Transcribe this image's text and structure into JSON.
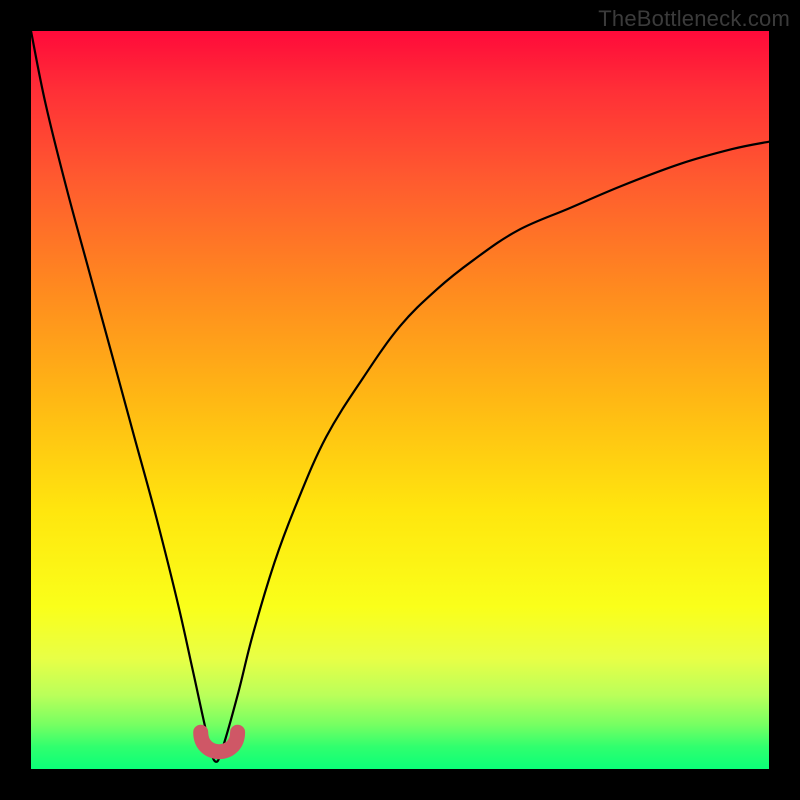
{
  "watermark": "TheBottleneck.com",
  "chart_data": {
    "type": "line",
    "title": "",
    "xlabel": "",
    "ylabel": "",
    "xlim": [
      0,
      100
    ],
    "ylim": [
      0,
      100
    ],
    "background_gradient": {
      "orientation": "vertical",
      "stops": [
        {
          "pos": 0.0,
          "color": "#ff0a3a"
        },
        {
          "pos": 0.5,
          "color": "#ffe60e"
        },
        {
          "pos": 0.9,
          "color": "#baff5a"
        },
        {
          "pos": 1.0,
          "color": "#0bff78"
        }
      ]
    },
    "series": [
      {
        "name": "bottleneck-curve",
        "note": "V-shaped curve; minimum at x≈25, curve reaches near zero there and rises sharply on both sides",
        "x": [
          0,
          2,
          5,
          8,
          11,
          14,
          17,
          20,
          22,
          24,
          25,
          26,
          28,
          30,
          33,
          36,
          40,
          45,
          50,
          55,
          60,
          66,
          73,
          80,
          88,
          95,
          100
        ],
        "y": [
          100,
          90,
          78,
          67,
          56,
          45,
          34,
          22,
          13,
          4,
          1,
          3,
          10,
          18,
          28,
          36,
          45,
          53,
          60,
          65,
          69,
          73,
          76,
          79,
          82,
          84,
          85
        ]
      }
    ],
    "highlight": {
      "name": "min-region",
      "approx_x_range": [
        23,
        28
      ],
      "approx_y": 2,
      "color": "#cf5766"
    }
  }
}
